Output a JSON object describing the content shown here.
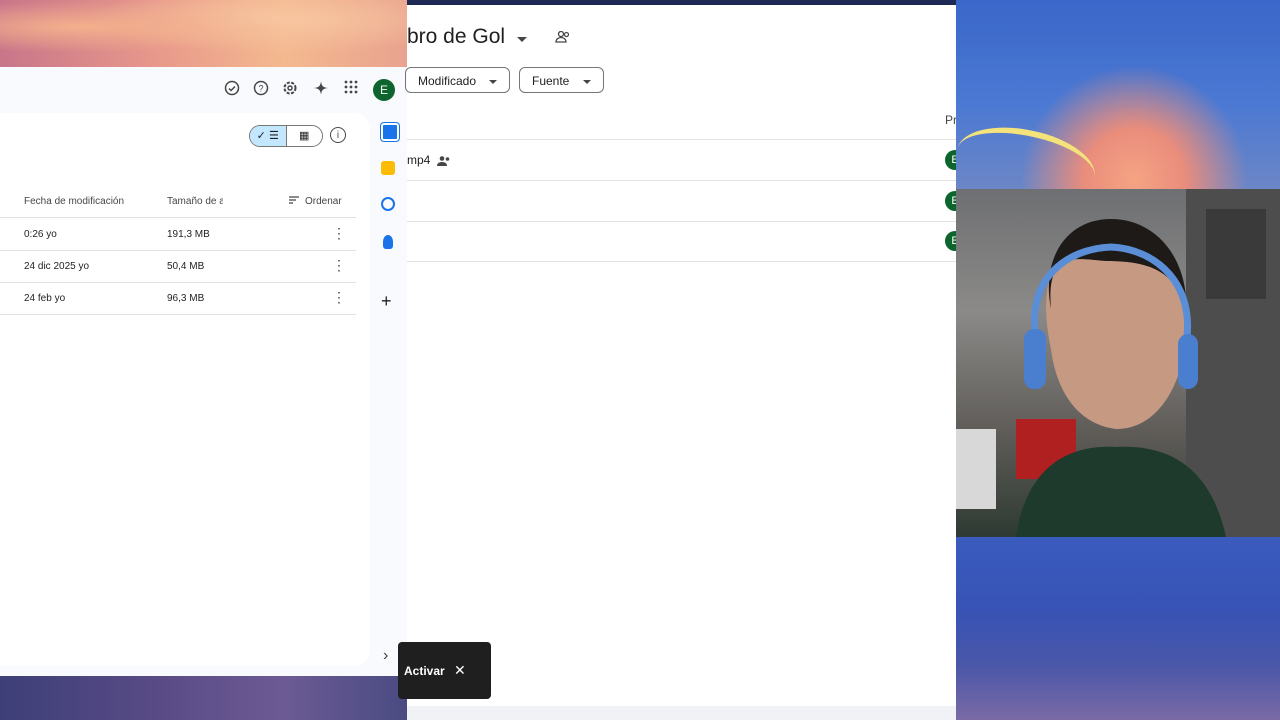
{
  "left_window": {
    "avatar_initial": "E",
    "toolbar_icons": [
      "offline-check-icon",
      "help-icon",
      "settings-icon",
      "gemini-spark-icon",
      "apps-grid-icon"
    ],
    "view_toggle": {
      "list_label": "✓ ☰",
      "grid_label": "▦"
    },
    "columns": {
      "modified": "Fecha de modificación",
      "size": "Tamaño de a",
      "sort": "Ordenar"
    },
    "rows": [
      {
        "modified": "0:26 yo",
        "size": "191,3 MB"
      },
      {
        "modified": "24 dic 2025 yo",
        "size": "50,4 MB"
      },
      {
        "modified": "24 feb yo",
        "size": "96,3 MB"
      }
    ]
  },
  "side_panel": {
    "apps": [
      "calendar-icon",
      "keep-icon",
      "tasks-icon",
      "contacts-icon"
    ],
    "add_label": "+",
    "expand_label": "›"
  },
  "center_window": {
    "folder_title": "bro de Gol",
    "filters": {
      "modified": "Modificado",
      "source": "Fuente"
    },
    "owner_header": "Pr",
    "rows": [
      {
        "name": "mp4",
        "owner_initial": "E"
      },
      {
        "name": "",
        "owner_initial": "E"
      },
      {
        "name": "",
        "owner_initial": "E"
      }
    ]
  },
  "snackbar": {
    "action": "Activar",
    "close": "✕"
  }
}
